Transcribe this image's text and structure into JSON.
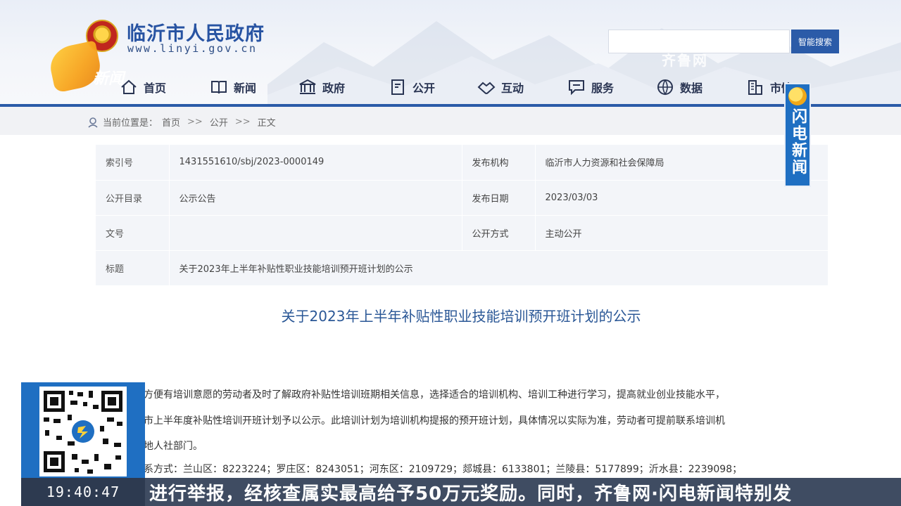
{
  "header": {
    "site_title": "临沂市人民政府",
    "site_url": "www.linyi.gov.cn",
    "search_button": "智能搜索",
    "search_placeholder": "",
    "watermark": "齐鲁网",
    "overlay_logo": "新闻"
  },
  "nav": {
    "items": [
      {
        "label": "首页",
        "icon": "home-icon"
      },
      {
        "label": "新闻",
        "icon": "book-icon"
      },
      {
        "label": "政府",
        "icon": "building-icon"
      },
      {
        "label": "公开",
        "icon": "document-icon"
      },
      {
        "label": "互动",
        "icon": "handshake-icon"
      },
      {
        "label": "服务",
        "icon": "chat-icon"
      },
      {
        "label": "数据",
        "icon": "globe-icon"
      },
      {
        "label": "市情",
        "icon": "city-icon"
      }
    ]
  },
  "breadcrumb": {
    "prefix": "当前位置是：",
    "items": [
      "首页",
      "公开",
      "正文"
    ],
    "separator": ">>"
  },
  "info_table": {
    "rows": [
      {
        "k1": "索引号",
        "v1": "1431551610/sbj/2023-0000149",
        "k2": "发布机构",
        "v2": "临沂市人力资源和社会保障局"
      },
      {
        "k1": "公开目录",
        "v1": "公示公告",
        "k2": "发布日期",
        "v2": "2023/03/03"
      },
      {
        "k1": "文号",
        "v1": "",
        "k2": "公开方式",
        "v2": "主动公开"
      },
      {
        "k1": "标题",
        "v1": "关于2023年上半年补贴性职业技能培训预开班计划的公示",
        "k2": "",
        "v2": ""
      }
    ]
  },
  "article": {
    "title": "关于2023年上半年补贴性职业技能培训预开班计划的公示",
    "lines": [
      "方便有培训意愿的劳动者及时了解政府补贴性培训班期相关信息，选择适合的培训机构、培训工种进行学习，提高就业创业技能水平，",
      "市上半年度补贴性培训开班计划予以公示。此培训计划为培训机构提报的预开班计划，具体情况以实际为准，劳动者可提前联系培训机",
      "地人社部门。",
      "系方式：兰山区：8223224；罗庄区：8243051；河东区：2109729；郯城县：6133801；兰陵县：5177899；沂水县：2239098；"
    ]
  },
  "overlay": {
    "channel_logo": "闪电新闻",
    "clock": "19:40:47",
    "ticker": "进行举报，经核查属实最高给予50万元奖励。同时，齐鲁网·闪电新闻特别发"
  },
  "colors": {
    "brand_blue": "#2b5ba8",
    "title_blue": "#2a5796",
    "channel_blue": "#1f6fc2",
    "ticker_bg": "#3f4c62"
  }
}
